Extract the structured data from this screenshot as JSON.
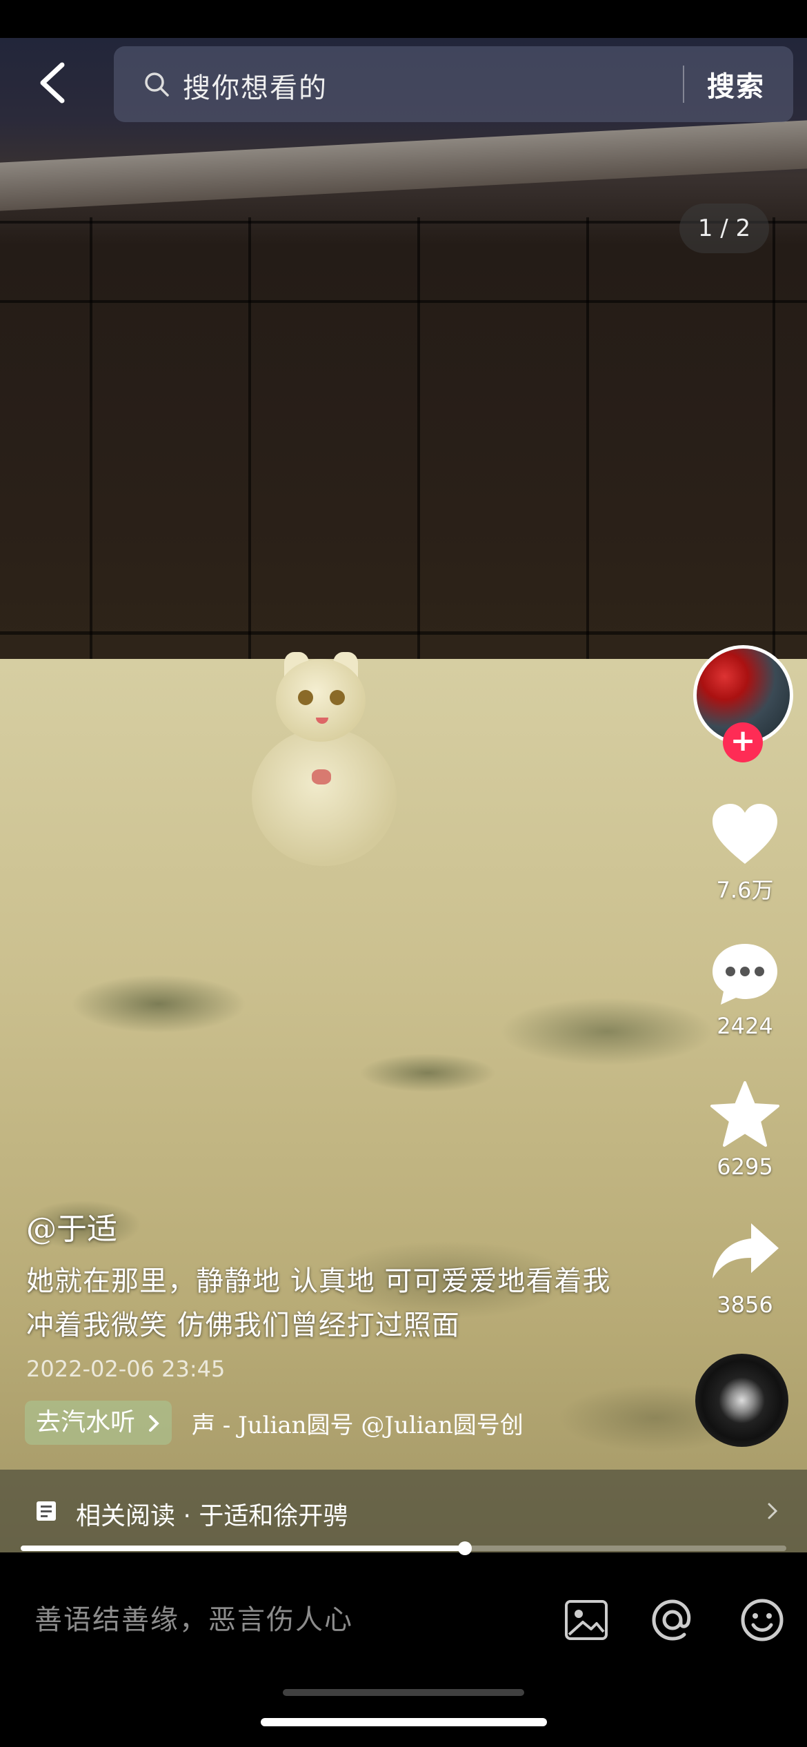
{
  "header": {
    "search_placeholder": "搜你想看的",
    "search_button": "搜索",
    "page_indicator": "1 / 2"
  },
  "rail": {
    "likes": "7.6万",
    "comments": "2424",
    "favorites": "6295",
    "shares": "3856"
  },
  "post": {
    "author": "@于适",
    "description": "她就在那里，静静地  认真地  可可爱爱地看着我  冲着我微笑  仿佛我们曾经打过照面",
    "date": "2022-02-06 23:45",
    "listen_chip": "去汽水听",
    "music": "声 - Julian圆号       @Julian圆号创"
  },
  "related": {
    "label": "相关阅读 · 于适和徐开骋"
  },
  "progress": {
    "fraction": 0.58
  },
  "comment_bar": {
    "placeholder": "善语结善缘，恶言伤人心"
  },
  "colors": {
    "follow_accent": "#fe2c55"
  },
  "icons": [
    "back-arrow-icon",
    "search-icon",
    "heart-icon",
    "comment-icon",
    "star-icon",
    "share-icon",
    "article-icon",
    "chevron-right-icon",
    "image-icon",
    "at-icon",
    "emoji-icon"
  ]
}
